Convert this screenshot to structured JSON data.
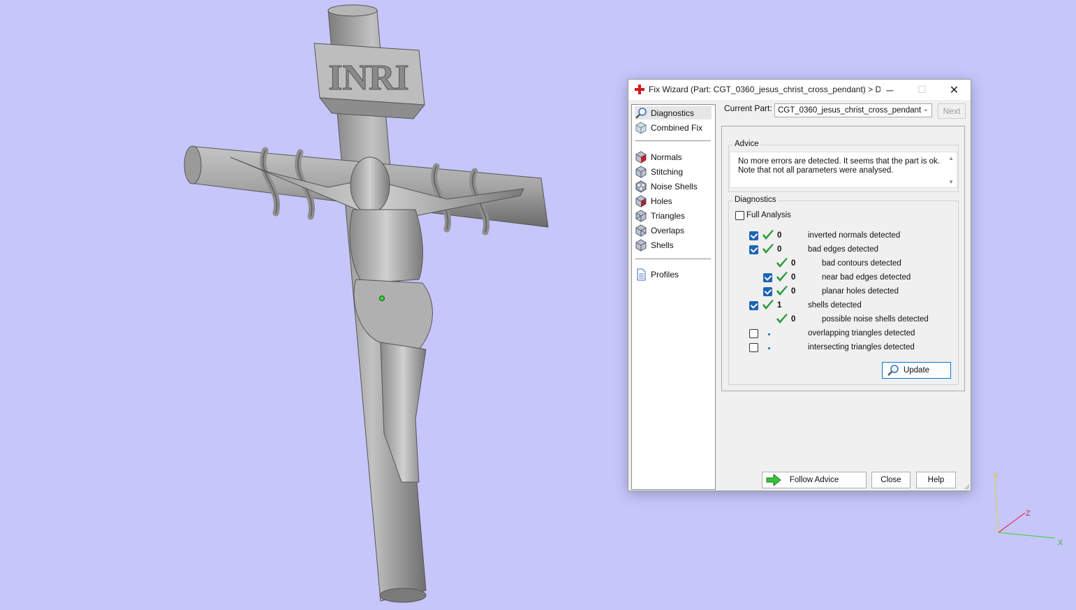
{
  "window": {
    "title": "Fix Wizard (Part: CGT_0360_jesus_christ_cross_pendant) > D...",
    "minimize": "─",
    "maximize": "☐",
    "close": "✕"
  },
  "sidebar": {
    "items": [
      {
        "label": "Diagnostics",
        "icon": "magnifier-icon",
        "active": true
      },
      {
        "label": "Combined Fix",
        "icon": "cube-light-icon"
      },
      {
        "label": "Normals",
        "icon": "normals-cube-icon"
      },
      {
        "label": "Stitching",
        "icon": "stitching-cube-icon"
      },
      {
        "label": "Noise Shells",
        "icon": "noise-shells-icon"
      },
      {
        "label": "Holes",
        "icon": "holes-cube-icon"
      },
      {
        "label": "Triangles",
        "icon": "triangles-cube-icon"
      },
      {
        "label": "Overlaps",
        "icon": "overlaps-cube-icon"
      },
      {
        "label": "Shells",
        "icon": "shells-cube-icon"
      },
      {
        "label": "Profiles",
        "icon": "document-icon"
      }
    ]
  },
  "current_part": {
    "label": "Current Part:",
    "value": "CGT_0360_jesus_christ_cross_pendant",
    "next_label": "Next"
  },
  "advice": {
    "label": "Advice",
    "text_line1": "No more errors are detected. It seems that the part is ok.",
    "text_line2": "Note that not all parameters were analysed."
  },
  "diagnostics": {
    "label": "Diagnostics",
    "full_analysis_label": "Full Analysis",
    "full_analysis_checked": false,
    "rows": [
      {
        "count": "0",
        "label": "inverted normals detected",
        "checked": true,
        "status": "ok"
      },
      {
        "count": "0",
        "label": "bad edges detected",
        "checked": true,
        "status": "ok"
      },
      {
        "count": "0",
        "label": "bad contours detected",
        "checked": null,
        "status": "ok"
      },
      {
        "count": "0",
        "label": "near bad edges detected",
        "checked": true,
        "status": "ok"
      },
      {
        "count": "0",
        "label": "planar holes detected",
        "checked": true,
        "status": "ok"
      },
      {
        "count": "1",
        "label": "shells detected",
        "checked": true,
        "status": "ok"
      },
      {
        "count": "0",
        "label": "possible noise shells detected",
        "checked": null,
        "status": "ok"
      },
      {
        "count": "",
        "label": "overlapping triangles detected",
        "checked": false,
        "status": "pending"
      },
      {
        "count": "",
        "label": "intersecting triangles detected",
        "checked": false,
        "status": "pending"
      }
    ],
    "update_label": "Update"
  },
  "footer": {
    "follow_advice_label": "Follow Advice",
    "close_label": "Close",
    "help_label": "Help"
  },
  "viewport": {
    "inscription": "INRI",
    "axis_x": "X",
    "axis_y": "Y",
    "axis_z": "Z"
  },
  "colors": {
    "background": "#c6c6fb",
    "model": "#9c9c9c",
    "check_accent": "#1e64b4",
    "ok_tick": "#2b9a3c"
  }
}
